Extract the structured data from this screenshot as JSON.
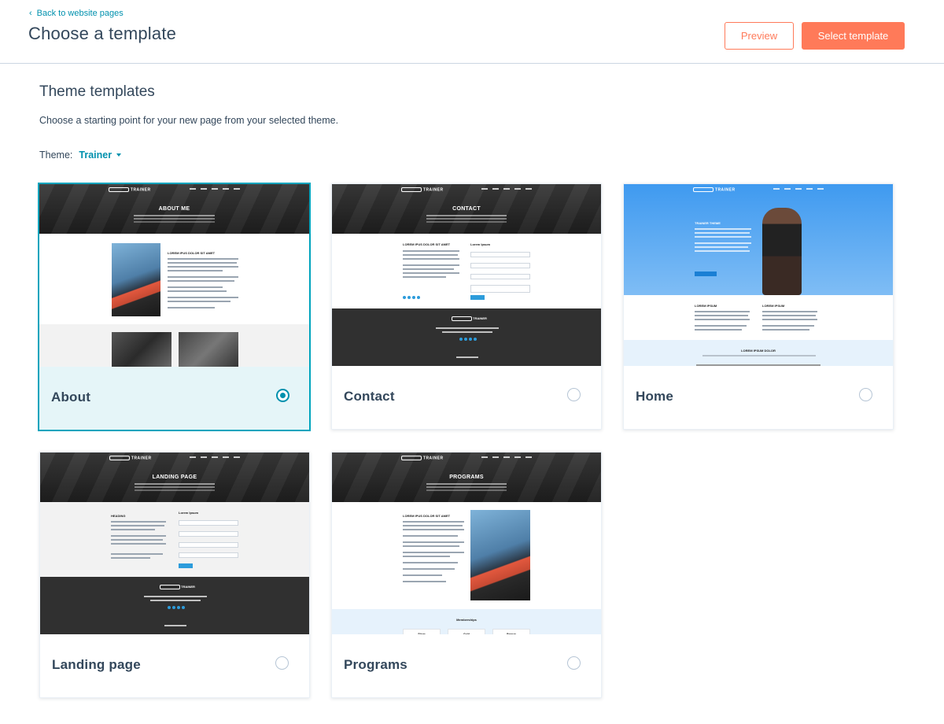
{
  "header": {
    "back_label": "Back to website pages",
    "title": "Choose a template",
    "preview_label": "Preview",
    "select_label": "Select template"
  },
  "content": {
    "section_title": "Theme templates",
    "description": "Choose a starting point for your new page from your selected theme.",
    "theme_label": "Theme:",
    "theme_value": "Trainer"
  },
  "templates": [
    {
      "label": "About",
      "selected": true,
      "hero_title": "ABOUT ME"
    },
    {
      "label": "Contact",
      "selected": false,
      "hero_title": "CONTACT"
    },
    {
      "label": "Home",
      "selected": false,
      "hero_title": "TRAINER THEME"
    },
    {
      "label": "Landing page",
      "selected": false,
      "hero_title": "LANDING PAGE"
    },
    {
      "label": "Programs",
      "selected": false,
      "hero_title": "PROGRAMS"
    }
  ],
  "thumb_text": {
    "brand": "TRAINER",
    "lorem_heading": "LOREM IPUS DOLOR SIT AMET",
    "lorem_ipsum": "Lorem Ipsum",
    "lorem_ipsum_upper": "LOREM IPSUM",
    "lorem_ipsum_dolor": "LOREM IPSUM DOLOR",
    "heading": "HEADING",
    "memberships": "Memberships",
    "silver": "Silver",
    "gold": "Gold",
    "bronze": "Bronze"
  },
  "colors": {
    "accent": "#ff7a59",
    "link": "#0091ae",
    "selected_border": "#00a4bd",
    "selected_bg": "#e5f5f8",
    "text": "#33475b"
  },
  "icons": {
    "back": "chevron-left-icon",
    "theme_dropdown": "caret-down-icon",
    "radio": "radio-icon"
  }
}
